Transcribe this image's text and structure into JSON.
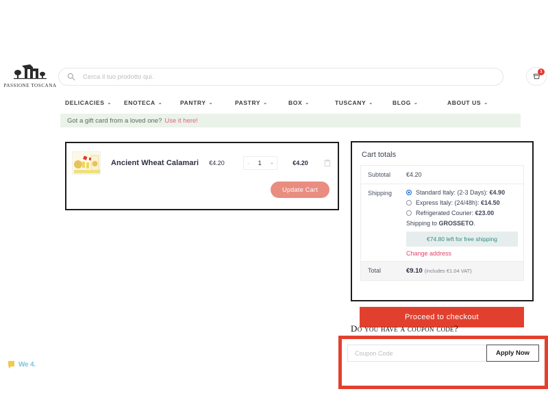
{
  "header": {
    "logo_name": "logo-passione-toscana",
    "logo_caption": "PASSIONE TOSCANA",
    "search": {
      "icon": "search-icon",
      "placeholder": "Cerca il tuo prodotto qui.",
      "value": ""
    },
    "cart_icon": "shopping-cart-icon",
    "cart_count": "1",
    "wishlist_icon": "heart-icon"
  },
  "nav": {
    "items": [
      {
        "label": "DELICACIES",
        "has_dropdown": true
      },
      {
        "label": "ENOTECA",
        "has_dropdown": true
      },
      {
        "label": "PANTRY",
        "has_dropdown": true
      },
      {
        "label": "PASTRY",
        "has_dropdown": true
      },
      {
        "label": "BOX",
        "has_dropdown": true
      },
      {
        "label": "TUSCANY",
        "has_dropdown": true
      },
      {
        "label": "BLOG",
        "has_dropdown": true
      },
      {
        "label": "ABOUT US",
        "has_dropdown": true
      }
    ],
    "caret_glyph": "⌄"
  },
  "gift_banner": {
    "text": "Got a gift card from a loved one?",
    "link": "Use it here!"
  },
  "cart": {
    "item": {
      "thumbnail_name": "product-thumbnail-ancient-wheat-calamari",
      "name": "Ancient Wheat Calamari",
      "unit_price": "€4.20",
      "qty_minus": "-",
      "qty_value": "1",
      "qty_plus": "+",
      "line_total": "€4.20",
      "remove_icon": "trash-icon"
    },
    "update_label": "Update Cart"
  },
  "totals": {
    "title": "Cart totals",
    "subtotal_label": "Subtotal",
    "subtotal_value": "€4.20",
    "shipping_label": "Shipping",
    "shipping_options": [
      {
        "label": "Standard Italy: (2-3 Days): ",
        "price": "€4.90",
        "selected": true
      },
      {
        "label": "Express Italy: (24/48h): ",
        "price": "€14.50",
        "selected": false
      },
      {
        "label": "Refrigerated Courier: ",
        "price": "€23.00",
        "selected": false
      }
    ],
    "shipping_to_prefix": "Shipping to ",
    "shipping_to_city": "GROSSETO",
    "shipping_to_suffix": ".",
    "free_shipping_notice": "€74.80 left for free shipping",
    "change_address": "Change address",
    "total_label": "Total",
    "total_value": "€9.10",
    "total_vat": "(includes €1.04 VAT)"
  },
  "checkout": {
    "button_label": "Proceed to checkout"
  },
  "coupon": {
    "heading": "Do you have a coupon code?",
    "placeholder": "Coupon Code",
    "value": "",
    "apply_label": "Apply Now"
  },
  "widget": {
    "label": "We 4.",
    "icon": "chat-widget-icon"
  },
  "colors": {
    "accent_red": "#e2402e",
    "salmon": "#e98d80",
    "pink_link": "#e8416b",
    "teal": "#2e8b84",
    "gift_bg": "#eaf2ea",
    "radio_blue": "#1a66d6"
  }
}
